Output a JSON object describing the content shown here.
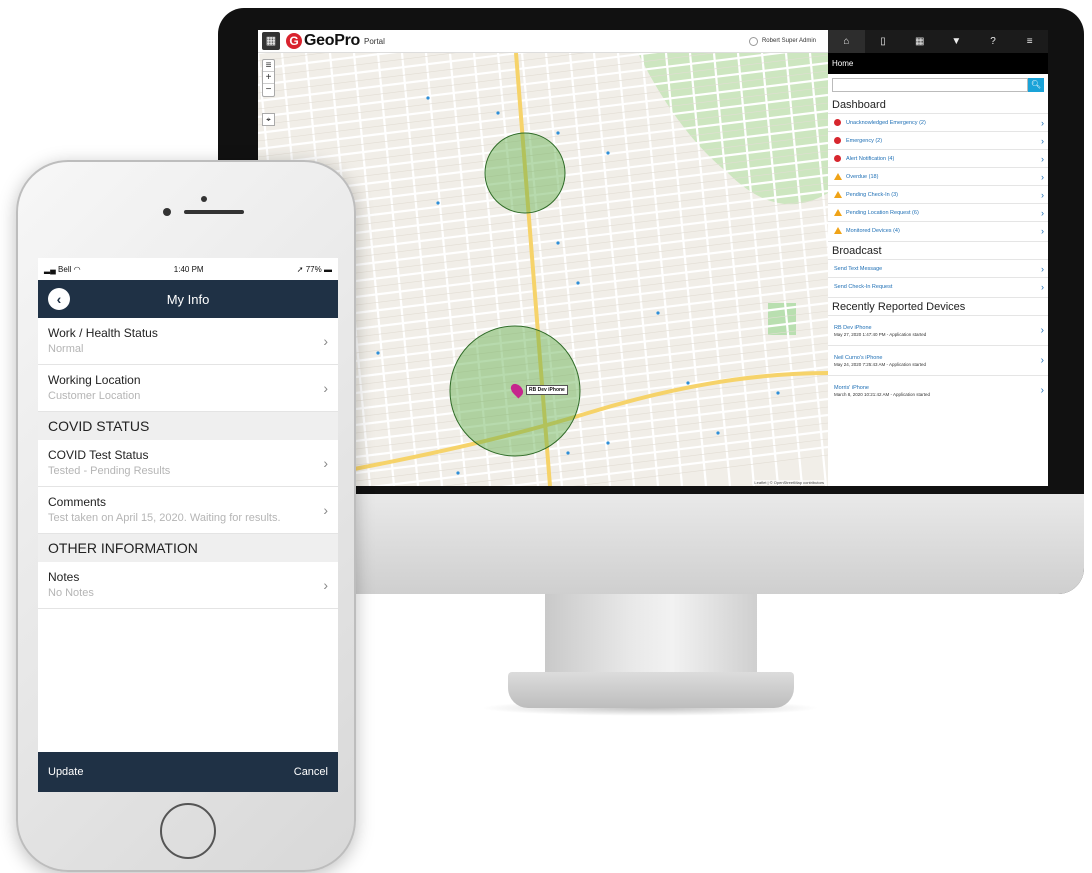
{
  "portal": {
    "logo_text": "GeoPro",
    "logo_mark": "G",
    "logo_sub": "Portal",
    "user_name": "Robert Super Admin",
    "grid_icon": "grid-icon",
    "map": {
      "zoom_in": "+",
      "zoom_out": "−",
      "layers": "≡",
      "locate": "⌖",
      "device_marker_label": "RB Dev iPhone",
      "attribution": "Leaflet | © OpenStreetMap contributors",
      "geofence_color": "#5fae4a",
      "road_color": "#f6d36a"
    },
    "panel": {
      "tabs": [
        "⌂",
        "▯",
        "▦",
        "▼",
        "?",
        "≡"
      ],
      "home_label": "Home",
      "search_placeholder": "",
      "search_icon": "search-icon",
      "dashboard_title": "Dashboard",
      "dashboard_items": [
        {
          "label": "Unacknowledged Emergency (2)",
          "icon": "red"
        },
        {
          "label": "Emergency (2)",
          "icon": "red"
        },
        {
          "label": "Alert Notification (4)",
          "icon": "red"
        },
        {
          "label": "Overdue (18)",
          "icon": "yellow"
        },
        {
          "label": "Pending Check-In (3)",
          "icon": "yellow"
        },
        {
          "label": "Pending Location Request (6)",
          "icon": "yellow"
        },
        {
          "label": "Monitored Devices (4)",
          "icon": "yellow"
        }
      ],
      "broadcast_title": "Broadcast",
      "broadcast_items": [
        "Send Text Message",
        "Send Check-In Request"
      ],
      "recent_title": "Recently Reported Devices",
      "recent_devices": [
        {
          "name": "RB Dev iPhone",
          "meta": "May 27, 2020 1:47:40 PM - Application started"
        },
        {
          "name": "Neil Curno's iPhone",
          "meta": "May 24, 2020 7:25:43 AM - Application started"
        },
        {
          "name": "Morris' iPhone",
          "meta": "March 8, 2020 10:21:42 AM - Application started"
        }
      ],
      "accent_color": "#1aa3d8",
      "link_color": "#1e6fb5"
    }
  },
  "phone": {
    "status": {
      "carrier": "Bell",
      "time": "1:40 PM",
      "battery": "77%"
    },
    "nav_title": "My Info",
    "items_top": [
      {
        "label": "Work / Health Status",
        "value": "Normal"
      },
      {
        "label": "Working Location",
        "value": "Customer Location"
      }
    ],
    "section_covid": "COVID STATUS",
    "items_covid": [
      {
        "label": "COVID Test Status",
        "value": "Tested - Pending Results"
      },
      {
        "label": "Comments",
        "value": "Test taken on April 15, 2020. Waiting for results."
      }
    ],
    "section_other": "OTHER INFORMATION",
    "items_other": [
      {
        "label": "Notes",
        "value": "No Notes"
      }
    ],
    "update_label": "Update",
    "cancel_label": "Cancel",
    "navbar_color": "#1f3145"
  }
}
